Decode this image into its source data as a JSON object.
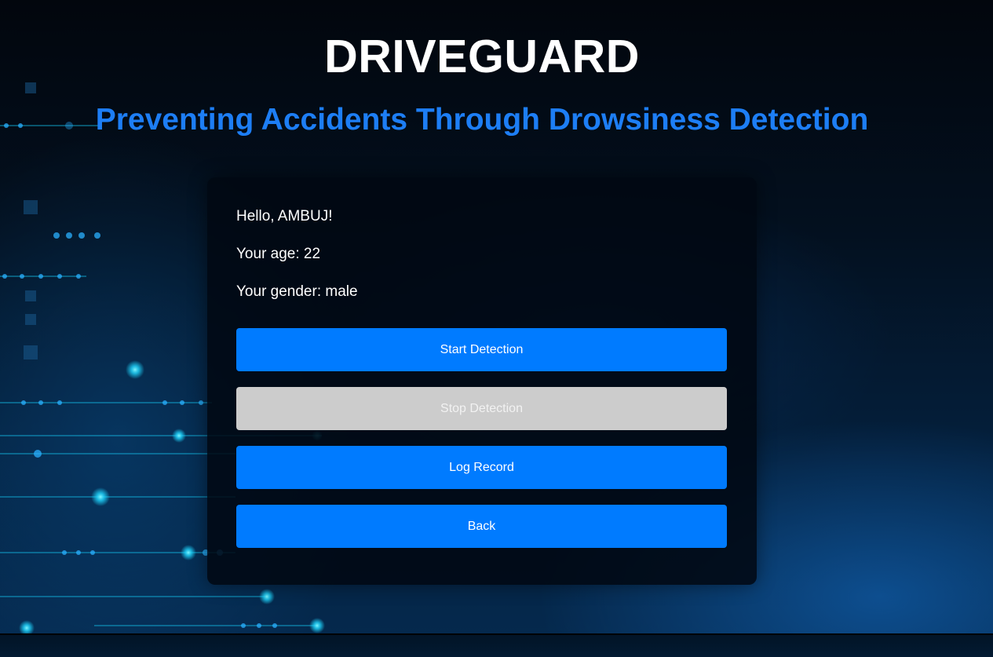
{
  "header": {
    "title": "DRIVEGUARD",
    "subtitle": "Preventing Accidents Through Drowsiness Detection"
  },
  "user": {
    "greeting": "Hello, AMBUJ!",
    "age_line": "Your age: 22",
    "gender_line": "Your gender: male"
  },
  "actions": {
    "start_label": "Start Detection",
    "stop_label": "Stop Detection",
    "log_label": "Log Record",
    "back_label": "Back"
  },
  "colors": {
    "primary_button": "#007bff",
    "disabled_button": "#cccccc",
    "subtitle": "#1d7ef5",
    "card_background": "#010812"
  }
}
